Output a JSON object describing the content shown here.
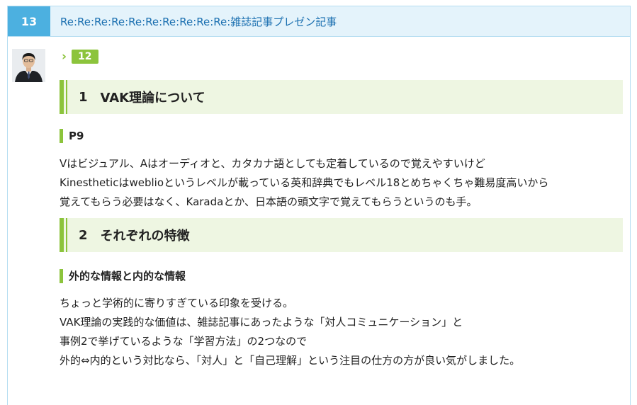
{
  "post": {
    "number": "13",
    "title": "Re:Re:Re:Re:Re:Re:Re:Re:Re:Re:雑誌記事プレゼン記事",
    "reply_to": "12"
  },
  "content": {
    "section1": {
      "number": "1",
      "title": "VAK理論について",
      "subheading": "P9",
      "lines": [
        "Vはビジュアル、Aはオーディオと、カタカナ語としても定着しているので覚えやすいけど",
        "Kinestheticはweblioというレベルが載っている英和辞典でもレベル18とめちゃくちゃ難易度高いから",
        "覚えてもらう必要はなく、Karadaとか、日本語の頭文字で覚えてもらうというのも手。"
      ]
    },
    "section2": {
      "number": "2",
      "title": "それぞれの特徴",
      "subheading": "外的な情報と内的な情報",
      "lines": [
        "ちょっと学術的に寄りすぎている印象を受ける。",
        "VAK理論の実践的な価値は、雑誌記事にあったような「対人コミュニケーション」と",
        "事例2で挙げているような「学習方法」の2つなので",
        "外的⇔内的という対比なら、「対人」と「自己理解」という注目の仕方の方が良い気がしました。"
      ]
    }
  },
  "colors": {
    "accent_blue": "#4cb0e0",
    "header_bg": "#e4f3fb",
    "title_link": "#1a6fb0",
    "accent_green": "#8cc43c",
    "heading_bg": "#eef6e2"
  },
  "icons": {
    "avatar": "user-avatar-photo",
    "reply_arrow": "chevron-right-icon"
  }
}
